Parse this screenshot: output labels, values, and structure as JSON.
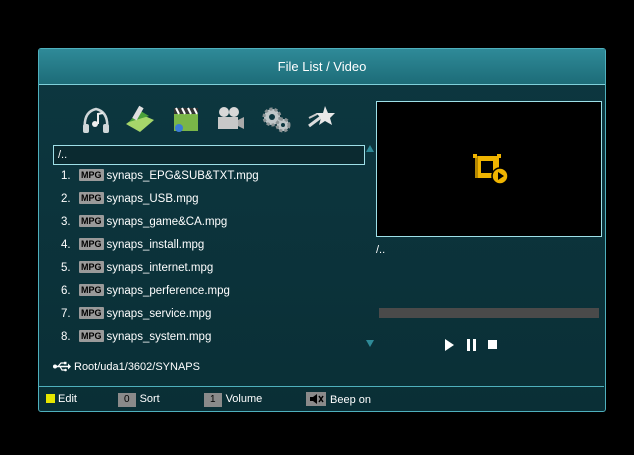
{
  "title": "File List / Video",
  "categories": [
    {
      "icon": "music-icon"
    },
    {
      "icon": "picture-icon"
    },
    {
      "icon": "movie-clapper-icon"
    },
    {
      "icon": "video-camera-icon"
    },
    {
      "icon": "gears-icon"
    },
    {
      "icon": "star-icon"
    }
  ],
  "path_row": "/..",
  "files": [
    {
      "index": "1.",
      "badge": "MPG",
      "name": "synaps_EPG&SUB&TXT.mpg"
    },
    {
      "index": "2.",
      "badge": "MPG",
      "name": "synaps_USB.mpg"
    },
    {
      "index": "3.",
      "badge": "MPG",
      "name": "synaps_game&CA.mpg"
    },
    {
      "index": "4.",
      "badge": "MPG",
      "name": "synaps_install.mpg"
    },
    {
      "index": "5.",
      "badge": "MPG",
      "name": "synaps_internet.mpg"
    },
    {
      "index": "6.",
      "badge": "MPG",
      "name": "synaps_perference.mpg"
    },
    {
      "index": "7.",
      "badge": "MPG",
      "name": "synaps_service.mpg"
    },
    {
      "index": "8.",
      "badge": "MPG",
      "name": "synaps_system.mpg"
    }
  ],
  "preview": {
    "icon": "video-file-icon",
    "path": "/.."
  },
  "playback": {
    "progress": 0
  },
  "status_path": "Root/uda1/3602/SYNAPS",
  "footer": {
    "edit_label": "Edit",
    "sort_key": "0",
    "sort_label": "Sort",
    "volume_key": "1",
    "volume_label": "Volume",
    "beep_label": "Beep on"
  },
  "colors": {
    "accent": "#2f8a98",
    "border": "#9fe0e8",
    "icon_orange": "#f0b400"
  }
}
